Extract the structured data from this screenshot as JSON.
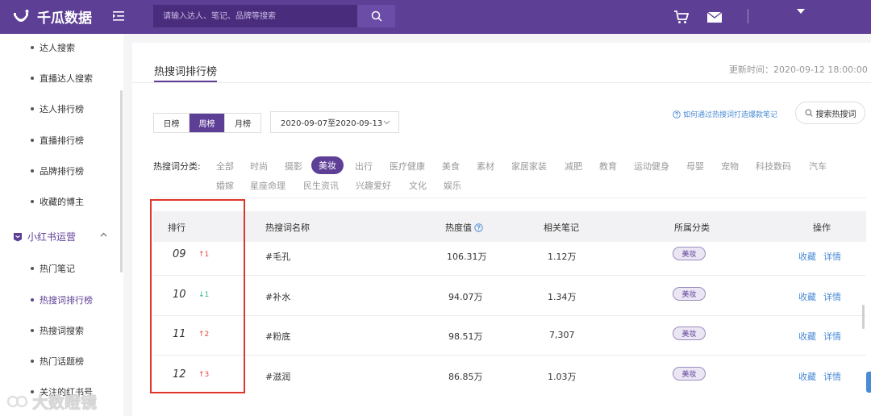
{
  "brand": {
    "name": "千瓜数据"
  },
  "search": {
    "placeholder": "请输入达人、笔记、品牌等搜索"
  },
  "sidebar": {
    "items_top": [
      "达人搜索",
      "直播达人搜索",
      "达人排行榜",
      "直播排行榜",
      "品牌排行榜",
      "收藏的博主"
    ],
    "group_label": "小红书运营",
    "items_bottom": [
      "热门笔记",
      "热搜词排行榜",
      "热搜词搜索",
      "热门话题榜",
      "关注的红书号"
    ],
    "active_item": "热搜词排行榜"
  },
  "watermark": {
    "text": "大数瞪镜"
  },
  "page": {
    "title": "热搜词排行榜",
    "update_time": "更新时间：2020-09-12 18:00:00"
  },
  "period_tabs": [
    "日榜",
    "周榜",
    "月榜"
  ],
  "date_range": "2020-09-07至2020-09-13",
  "help_link": "如何通过热搜词打造爆款笔记",
  "search_hot_button": "搜索热搜词",
  "categories": {
    "label": "热搜词分类:",
    "row1": [
      "全部",
      "时尚",
      "摄影",
      "美妆",
      "出行",
      "医疗健康",
      "美食",
      "素材",
      "家居家装",
      "减肥",
      "教育",
      "运动健身",
      "母婴",
      "宠物",
      "科技数码",
      "汽车"
    ],
    "row2": [
      "婚嫁",
      "星座命理",
      "民生资讯",
      "兴趣爱好",
      "文化",
      "娱乐"
    ],
    "active": "美妆"
  },
  "table": {
    "headers": {
      "rank": "排行",
      "keyword": "热搜词名称",
      "heat": "热度值",
      "notes": "相关笔记",
      "category": "所属分类",
      "actions": "操作"
    },
    "rows": [
      {
        "rank": "09",
        "change": "↑1",
        "dir": "up",
        "keyword": "#毛孔",
        "heat": "106.31万",
        "notes": "1.12万",
        "category": "美妆"
      },
      {
        "rank": "10",
        "change": "↓1",
        "dir": "down",
        "keyword": "#补水",
        "heat": "94.07万",
        "notes": "1.34万",
        "category": "美妆"
      },
      {
        "rank": "11",
        "change": "↑2",
        "dir": "up",
        "keyword": "#粉底",
        "heat": "98.51万",
        "notes": "7,307",
        "category": "美妆"
      },
      {
        "rank": "12",
        "change": "↑3",
        "dir": "up",
        "keyword": "#滋润",
        "heat": "86.85万",
        "notes": "1.03万",
        "category": "美妆"
      }
    ],
    "action_labels": {
      "favorite": "收藏",
      "detail": "详情"
    }
  },
  "colors": {
    "brand_purple": "#5e3f96",
    "link_blue": "#4a8bd6",
    "up_red": "#e64b3c",
    "down_green": "#2db87d",
    "highlight_red": "#e0352b"
  }
}
